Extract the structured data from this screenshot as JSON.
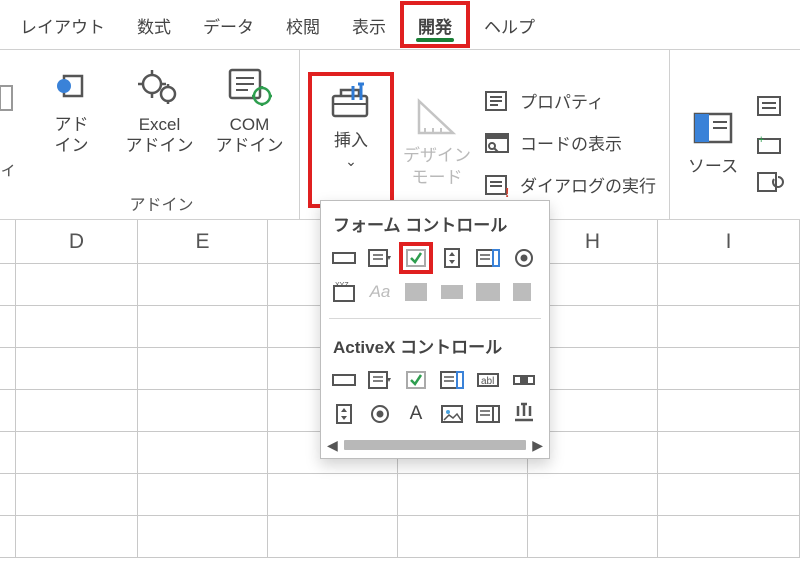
{
  "menu": {
    "items": [
      "レイアウト",
      "数式",
      "データ",
      "校閲",
      "表示",
      "開発",
      "ヘルプ"
    ],
    "active_index": 5
  },
  "ribbon": {
    "addins_group_label": "アドイン",
    "addin": "アド\nイン",
    "excel_addin": "Excel\nアドイン",
    "com_addin": "COM\nアドイン",
    "insert": "挿入",
    "design_mode": "デザイン\nモード",
    "properties": "プロパティ",
    "view_code": "コードの表示",
    "run_dialog": "ダイアログの実行",
    "source": "ソース"
  },
  "columns": [
    "D",
    "E",
    "",
    "",
    "H",
    "I"
  ],
  "popup": {
    "form_title": "フォーム コントロール",
    "activex_title": "ActiveX コントロール"
  }
}
